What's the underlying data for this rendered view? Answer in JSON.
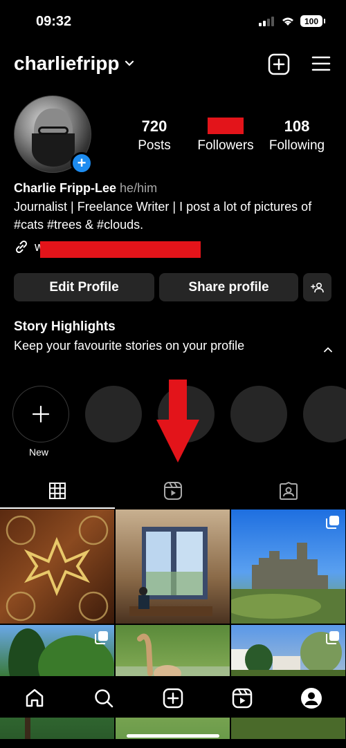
{
  "status_bar": {
    "time": "09:32",
    "battery": "100"
  },
  "header": {
    "username": "charliefripp"
  },
  "profile": {
    "stats": [
      {
        "value": "720",
        "label": "Posts"
      },
      {
        "value": "",
        "label": "Followers",
        "redacted": true
      },
      {
        "value": "108",
        "label": "Following"
      }
    ],
    "display_name": "Charlie Fripp-Lee",
    "pronouns": "he/him",
    "bio": "Journalist | Freelance Writer | I post a lot of pictures of #cats #trees & #clouds.",
    "link_prefix": "w"
  },
  "buttons": {
    "edit_profile": "Edit Profile",
    "share_profile": "Share profile"
  },
  "highlights": {
    "title": "Story Highlights",
    "description": "Keep your favourite stories on your profile",
    "new_label": "New"
  },
  "colors": {
    "background": "#000000",
    "button": "#262626",
    "accent_blue": "#1d8cf0",
    "redaction": "#e3141a"
  },
  "tabs": [
    "grid-icon",
    "reels-icon",
    "tagged-icon"
  ],
  "grid_posts": [
    {
      "description": "ornate-door"
    },
    {
      "description": "window-room"
    },
    {
      "description": "castle-sky",
      "multi": true
    },
    {
      "description": "trees",
      "multi": true
    },
    {
      "description": "cat-grass"
    },
    {
      "description": "village-trees",
      "multi": true
    }
  ],
  "bottom_nav": [
    "home-icon",
    "search-icon",
    "create-icon",
    "reels-icon",
    "profile-icon"
  ]
}
